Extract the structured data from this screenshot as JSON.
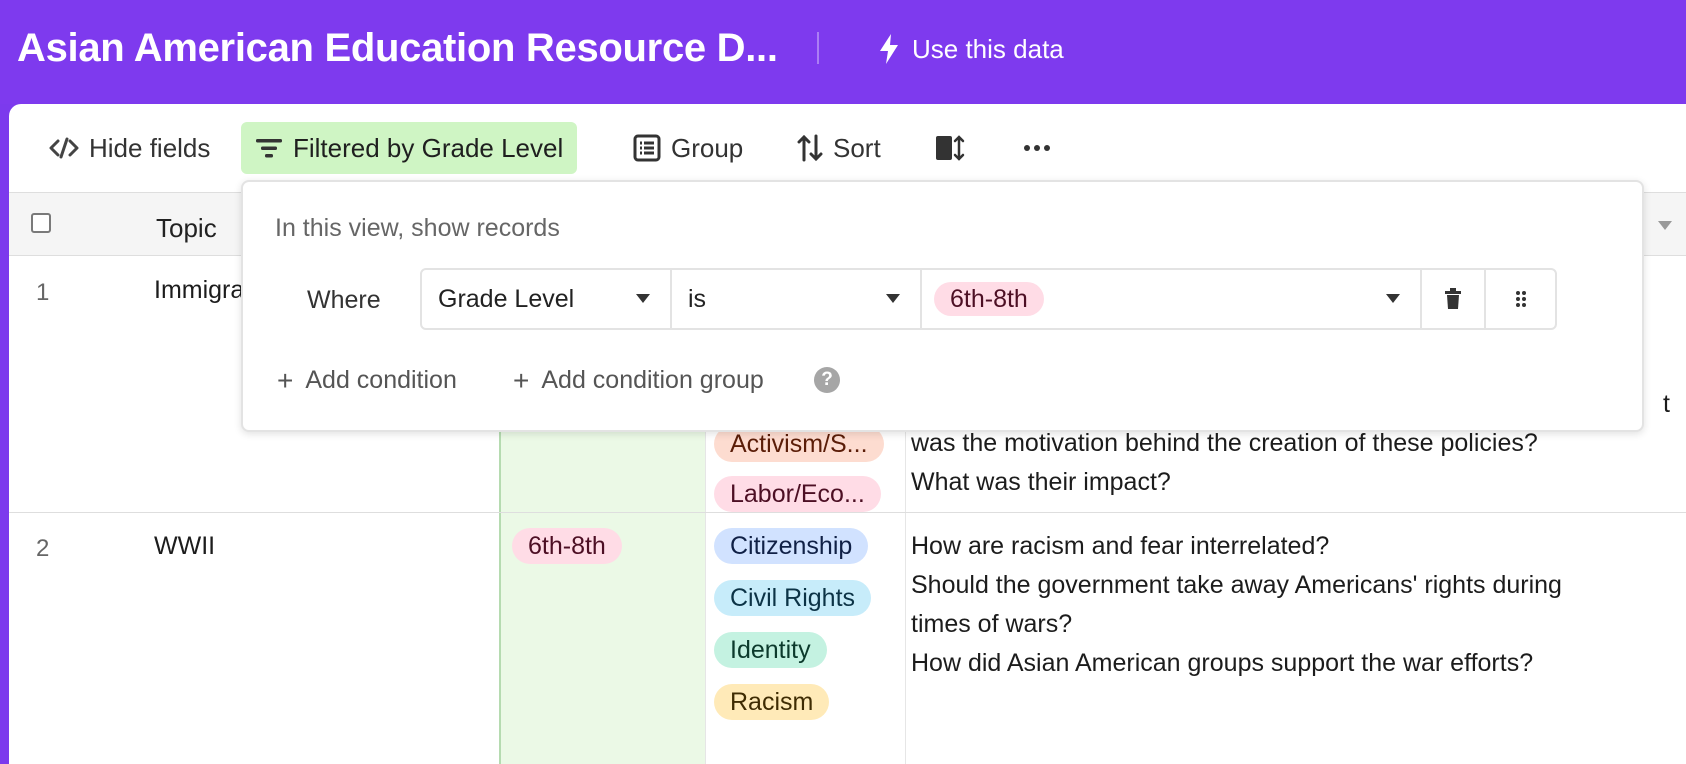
{
  "header": {
    "title": "Asian American Education Resource D...",
    "use_data_label": "Use this data"
  },
  "toolbar": {
    "hide_fields": "Hide fields",
    "filter": "Filtered by Grade Level",
    "group": "Group",
    "sort": "Sort"
  },
  "grid": {
    "columns": {
      "topic": "Topic"
    },
    "rows": [
      {
        "num": "1",
        "topic": "Immigra",
        "tags": [
          "Activism/S...",
          "Labor/Eco..."
        ],
        "questions": [
          "was the motivation behind the creation of these policies?",
          "What was their impact?"
        ],
        "clipped_char": "t"
      },
      {
        "num": "2",
        "topic": "WWII",
        "grade": "6th-8th",
        "tags": [
          "Citizenship",
          "Civil Rights",
          "Identity",
          "Racism"
        ],
        "questions": [
          "How are racism and fear interrelated?",
          "Should the government take away Americans' rights during",
          "times of wars?",
          "How did Asian American groups support the war efforts?"
        ]
      }
    ]
  },
  "filter_popover": {
    "heading": "In this view, show records",
    "where_label": "Where",
    "field": "Grade Level",
    "operator": "is",
    "value": "6th-8th",
    "add_condition": "Add condition",
    "add_condition_group": "Add condition group",
    "help_glyph": "?"
  },
  "colors": {
    "header_bg": "#7e3aee",
    "filter_active_bg": "#cff5c4",
    "grade_column_bg": "#ebf9e6"
  }
}
